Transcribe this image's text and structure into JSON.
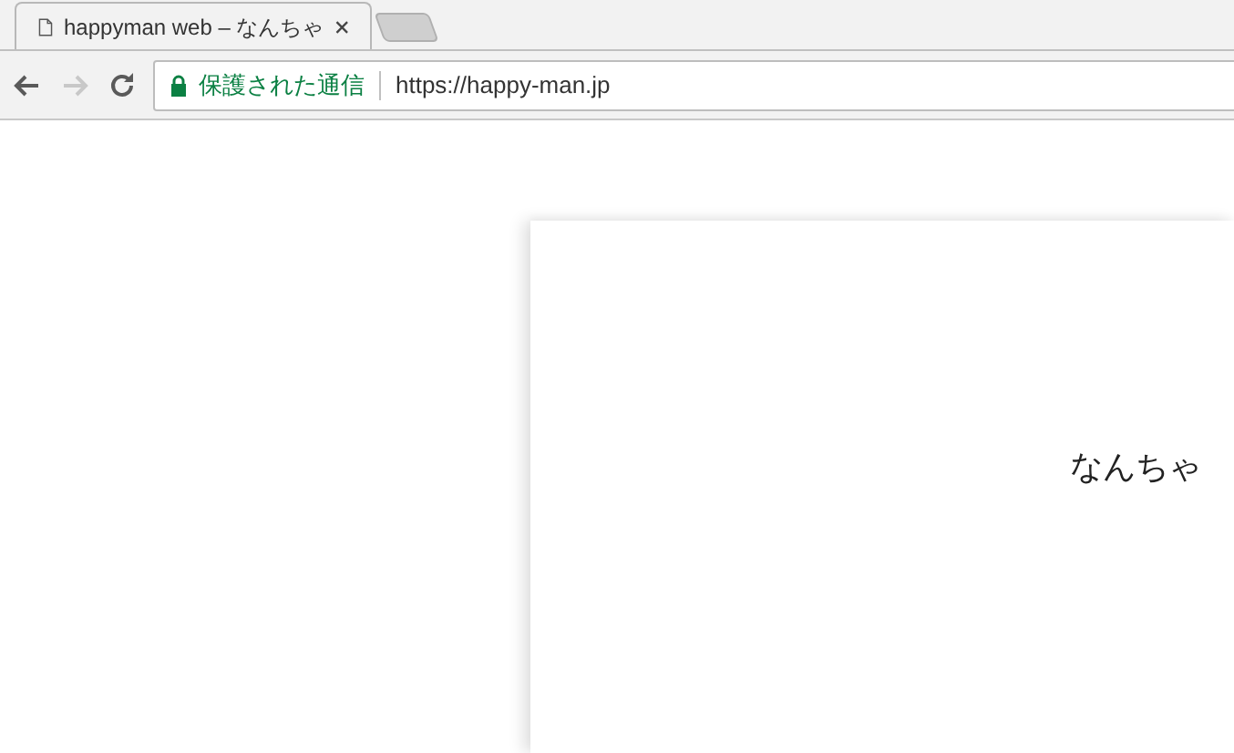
{
  "tabs": [
    {
      "title": "happyman web – なんちゃ",
      "selected": true
    }
  ],
  "toolbar": {
    "back": {
      "disabled": false
    },
    "forward": {
      "disabled": true
    }
  },
  "address_bar": {
    "security_label": "保護された通信",
    "url": "https://happy-man.jp"
  },
  "page": {
    "text": "なんちゃ"
  }
}
